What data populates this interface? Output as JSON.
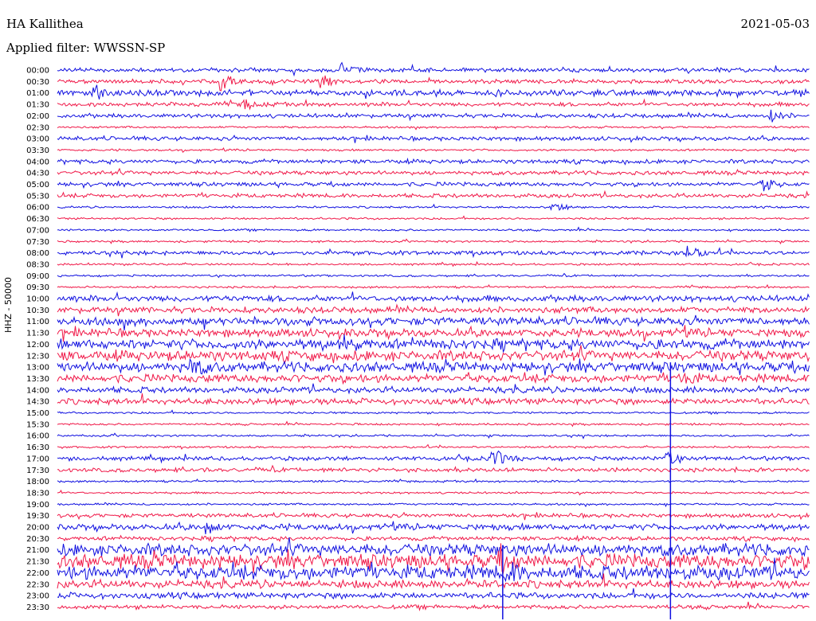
{
  "header": {
    "station": "HA Kallithea",
    "date": "2021-05-03",
    "filter": "Applied filter: WWSSN-SP"
  },
  "channel_label": "HHZ - 50000",
  "colors": {
    "blue": "#1010e0",
    "red": "#f01848"
  },
  "chart_data": {
    "type": "seismogram-helicorder",
    "traces_per_label": "30 min",
    "color_order": [
      "blue",
      "red"
    ],
    "tick_labels": [
      "00:00",
      "00:30",
      "01:00",
      "01:30",
      "02:00",
      "02:30",
      "03:00",
      "03:30",
      "04:00",
      "04:30",
      "05:00",
      "05:30",
      "06:00",
      "06:30",
      "07:00",
      "07:30",
      "08:00",
      "08:30",
      "09:00",
      "09:30",
      "10:00",
      "10:30",
      "11:00",
      "11:30",
      "12:00",
      "12:30",
      "13:00",
      "13:30",
      "14:00",
      "14:30",
      "15:00",
      "15:30",
      "16:00",
      "16:30",
      "17:00",
      "17:30",
      "18:00",
      "18:30",
      "19:00",
      "19:30",
      "20:00",
      "20:30",
      "21:00",
      "21:30",
      "22:00",
      "22:30",
      "23:00",
      "23:30"
    ],
    "noise_level": [
      2,
      2,
      3,
      2,
      2,
      1,
      2,
      1,
      2,
      2,
      2,
      2,
      1,
      1,
      1,
      1,
      2,
      1,
      1,
      1,
      3,
      3,
      4,
      4,
      5,
      5,
      5,
      4,
      3,
      3,
      1,
      1,
      1,
      1,
      2,
      2,
      1,
      1,
      1,
      2,
      3,
      2,
      6,
      7,
      7,
      4,
      3,
      2
    ],
    "events": [
      {
        "row": 0,
        "x": 0.38,
        "amp": 8
      },
      {
        "row": 1,
        "x": 0.22,
        "amp": 10
      },
      {
        "row": 1,
        "x": 0.35,
        "amp": 9
      },
      {
        "row": 2,
        "x": 0.05,
        "amp": 7
      },
      {
        "row": 3,
        "x": 0.25,
        "amp": 6
      },
      {
        "row": 4,
        "x": 0.95,
        "amp": 7
      },
      {
        "row": 10,
        "x": 0.94,
        "amp": 9
      },
      {
        "row": 12,
        "x": 0.66,
        "amp": 8
      },
      {
        "row": 16,
        "x": 0.84,
        "amp": 10
      },
      {
        "row": 24,
        "x": 0.38,
        "amp": 10
      },
      {
        "row": 26,
        "x": 0.18,
        "amp": 9
      },
      {
        "row": 27,
        "x": 0.83,
        "amp": 9
      },
      {
        "row": 34,
        "x": 0.58,
        "amp": 14
      },
      {
        "row": 34,
        "x": 0.81,
        "amp": 10
      },
      {
        "row": 40,
        "x": 0.2,
        "amp": 8
      },
      {
        "row": 43,
        "x": 0.59,
        "amp": 12
      },
      {
        "row": 44,
        "x": 0.6,
        "amp": 10
      }
    ],
    "vertical_spikes": [
      {
        "x": 0.815,
        "from_row": 26,
        "to_row": 47
      },
      {
        "x": 0.592,
        "from_row": 42,
        "to_row": 47
      }
    ]
  }
}
